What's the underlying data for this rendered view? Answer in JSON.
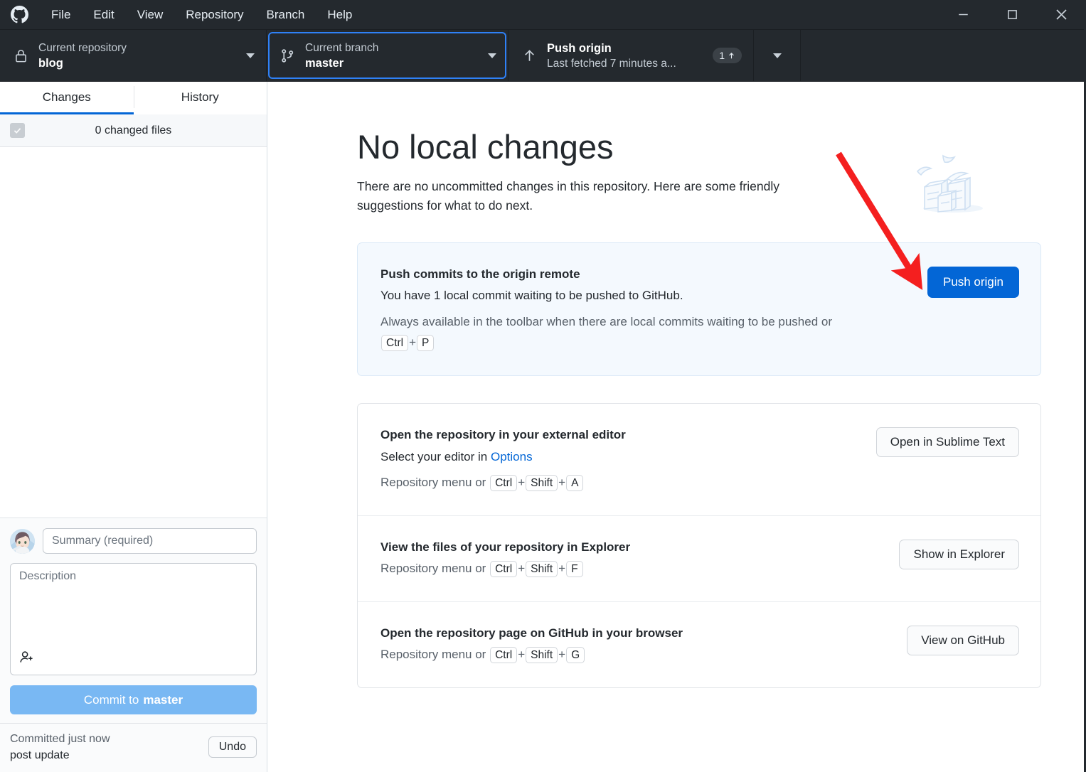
{
  "window": {
    "minimize_label": "Minimize",
    "maximize_label": "Maximize",
    "close_label": "Close"
  },
  "menubar": {
    "logo": "github-logo",
    "items": [
      {
        "label": "File"
      },
      {
        "label": "Edit"
      },
      {
        "label": "View"
      },
      {
        "label": "Repository"
      },
      {
        "label": "Branch"
      },
      {
        "label": "Help"
      }
    ]
  },
  "toolbar": {
    "repository": {
      "icon": "lock-icon",
      "label": "Current repository",
      "value": "blog"
    },
    "branch": {
      "icon": "branch-icon",
      "label": "Current branch",
      "value": "master",
      "focused": true
    },
    "push": {
      "icon": "arrow-up-icon",
      "label": "Push origin",
      "value": "Last fetched 7 minutes a...",
      "badge_count": "1",
      "badge_icon": "arrow-up-icon"
    }
  },
  "sidebar": {
    "tabs": [
      {
        "label": "Changes",
        "active": true
      },
      {
        "label": "History",
        "active": false
      }
    ],
    "changed_files_label": "0 changed files",
    "commit": {
      "avatar": "user-avatar",
      "summary_placeholder": "Summary (required)",
      "summary_value": "",
      "description_placeholder": "Description",
      "description_value": "",
      "coauthor_icon": "add-person-icon",
      "commit_button_prefix": "Commit to",
      "commit_button_branch": "master"
    },
    "status": {
      "line1": "Committed just now",
      "line2": "post update",
      "undo_label": "Undo"
    }
  },
  "main": {
    "heading": "No local changes",
    "intro": "There are no uncommitted changes in this repository. Here are some friendly suggestions for what to do next.",
    "illustration": "empty-boxes-illustration",
    "cards": [
      {
        "highlight": true,
        "title": "Push commits to the origin remote",
        "desc": "You have 1 local commit waiting to be pushed to GitHub.",
        "sub_prefix": "Always available in the toolbar when there are local commits waiting to be pushed or",
        "keys": [
          "Ctrl",
          "P"
        ],
        "button": "Push origin",
        "button_style": "primary"
      },
      {
        "highlight": false,
        "title": "Open the repository in your external editor",
        "desc_prefix": "Select your editor in",
        "desc_link": "Options",
        "sub_prefix": "Repository menu or",
        "keys": [
          "Ctrl",
          "Shift",
          "A"
        ],
        "button": "Open in Sublime Text",
        "button_style": "secondary"
      },
      {
        "highlight": false,
        "title": "View the files of your repository in Explorer",
        "sub_prefix": "Repository menu or",
        "keys": [
          "Ctrl",
          "Shift",
          "F"
        ],
        "button": "Show in Explorer",
        "button_style": "secondary"
      },
      {
        "highlight": false,
        "title": "Open the repository page on GitHub in your browser",
        "sub_prefix": "Repository menu or",
        "keys": [
          "Ctrl",
          "Shift",
          "G"
        ],
        "button": "View on GitHub",
        "button_style": "secondary"
      }
    ]
  },
  "annotation": {
    "type": "red-arrow",
    "color": "#ff1a1a",
    "points_to": "Push origin"
  },
  "colors": {
    "chrome": "#24292e",
    "accent": "#0366d6",
    "highlight_card": "#f4f9fe",
    "commit_button": "#79b8f3",
    "annotation_red": "#ff1a1a"
  }
}
